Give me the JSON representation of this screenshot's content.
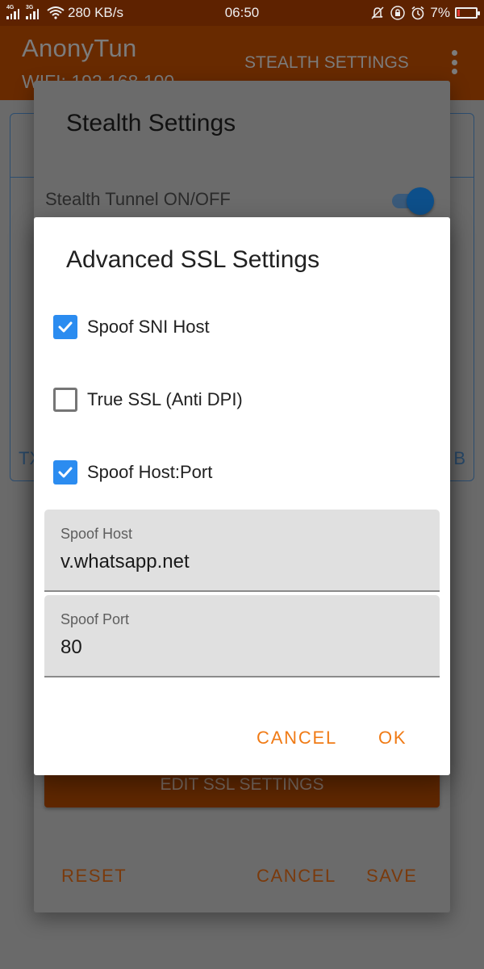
{
  "status_bar": {
    "network_1": "4G",
    "network_2": "3G",
    "speed": "280 KB/s",
    "time": "06:50",
    "battery": "7%",
    "battery_level": 0.07,
    "icons": [
      "signal-4g-icon",
      "signal-3g-icon",
      "wifi-icon",
      "mute-bell-icon",
      "rotation-lock-icon",
      "alarm-icon",
      "battery-icon"
    ]
  },
  "app_bar": {
    "title": "AnonyTun",
    "subtitle": "WIFI: 192.168.100",
    "action": "STEALTH SETTINGS",
    "overflow_icon": "more-vert-icon"
  },
  "background_card": {
    "left_label": "TX",
    "right_label": "B"
  },
  "stealth_dialog": {
    "title": "Stealth Settings",
    "tunnel_toggle_label": "Stealth Tunnel ON/OFF",
    "tunnel_toggle_on": true,
    "edit_ssl_button": "EDIT SSL SETTINGS",
    "reset_button": "RESET",
    "cancel_button": "CANCEL",
    "save_button": "SAVE"
  },
  "ssl_dialog": {
    "title": "Advanced SSL Settings",
    "options": [
      {
        "label": "Spoof SNI Host",
        "checked": true
      },
      {
        "label": "True SSL (Anti DPI)",
        "checked": false
      },
      {
        "label": "Spoof Host:Port",
        "checked": true
      }
    ],
    "spoof_host": {
      "label": "Spoof Host",
      "value": "v.whatsapp.net"
    },
    "spoof_port": {
      "label": "Spoof Port",
      "value": "80"
    },
    "cancel_button": "CANCEL",
    "ok_button": "OK"
  },
  "colors": {
    "primary": "#e65100",
    "accent_button_text": "#f07b16",
    "checkbox_checked": "#2b8cf0",
    "toggle_on": "#1565c0"
  }
}
